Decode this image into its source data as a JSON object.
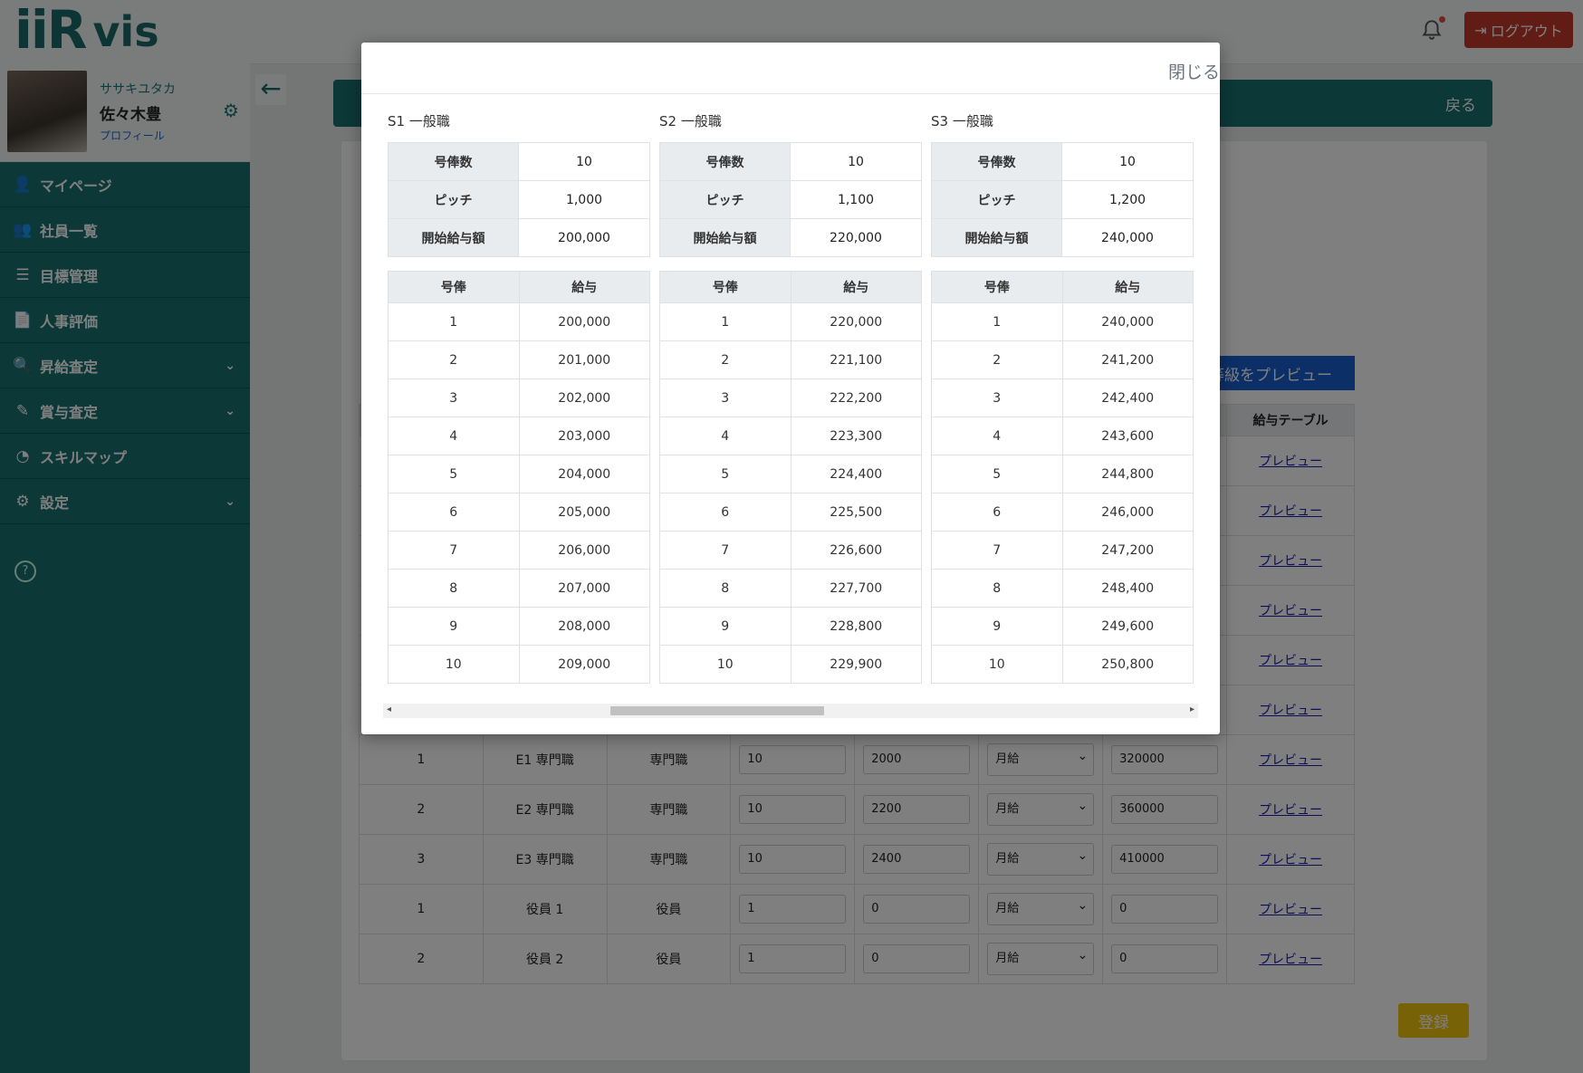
{
  "header": {
    "logo_text": "iiR",
    "logo_text2": "vis",
    "logout_label": "ログアウト"
  },
  "profile": {
    "kana": "ササキユタカ",
    "name": "佐々木豊",
    "link": "プロフィール"
  },
  "sidebar": {
    "items": [
      {
        "icon": "👤",
        "label": "マイページ",
        "chevron": ""
      },
      {
        "icon": "👥",
        "label": "社員一覧",
        "chevron": ""
      },
      {
        "icon": "☰",
        "label": "目標管理",
        "chevron": ""
      },
      {
        "icon": "📄",
        "label": "人事評価",
        "chevron": ""
      },
      {
        "icon": "🔍",
        "label": "昇給査定",
        "chevron": "⌄"
      },
      {
        "icon": "✎",
        "label": "賞与査定",
        "chevron": "⌄"
      },
      {
        "icon": "◔",
        "label": "スキルマップ",
        "chevron": ""
      },
      {
        "icon": "⚙",
        "label": "設定",
        "chevron": "⌄"
      }
    ]
  },
  "page": {
    "back_label": "戻る",
    "preview_all_label": "等級をプレビュー",
    "table_header_last": "給与テーブル",
    "register_label": "登録",
    "rows": [
      {
        "no": "1",
        "grade": "E1 専門職",
        "type": "専門職",
        "steps": "10",
        "pitch": "2000",
        "period": "月給",
        "start": "320000",
        "link": "プレビュー"
      },
      {
        "no": "2",
        "grade": "E2 専門職",
        "type": "専門職",
        "steps": "10",
        "pitch": "2200",
        "period": "月給",
        "start": "360000",
        "link": "プレビュー"
      },
      {
        "no": "3",
        "grade": "E3 専門職",
        "type": "専門職",
        "steps": "10",
        "pitch": "2400",
        "period": "月給",
        "start": "410000",
        "link": "プレビュー"
      },
      {
        "no": "1",
        "grade": "役員 1",
        "type": "役員",
        "steps": "1",
        "pitch": "0",
        "period": "月給",
        "start": "0",
        "link": "プレビュー"
      },
      {
        "no": "2",
        "grade": "役員 2",
        "type": "役員",
        "steps": "1",
        "pitch": "0",
        "period": "月給",
        "start": "0",
        "link": "プレビュー"
      }
    ],
    "hidden_links": [
      "プレビュー",
      "プレビュー",
      "プレビュー",
      "プレビュー",
      "プレビュー",
      "プレビュー"
    ]
  },
  "modal": {
    "close_label": "閉じる",
    "labels": {
      "steps": "号俸数",
      "pitch": "ピッチ",
      "start": "開始給与額",
      "col_step": "号俸",
      "col_salary": "給与"
    },
    "grades": [
      {
        "title": "S1 一般職",
        "steps": "10",
        "pitch": "1,000",
        "start": "200,000",
        "salaries": [
          "200,000",
          "201,000",
          "202,000",
          "203,000",
          "204,000",
          "205,000",
          "206,000",
          "207,000",
          "208,000",
          "209,000"
        ]
      },
      {
        "title": "S2 一般職",
        "steps": "10",
        "pitch": "1,100",
        "start": "220,000",
        "salaries": [
          "220,000",
          "221,100",
          "222,200",
          "223,300",
          "224,400",
          "225,500",
          "226,600",
          "227,700",
          "228,800",
          "229,900"
        ]
      },
      {
        "title": "S3 一般職",
        "steps": "10",
        "pitch": "1,200",
        "start": "240,000",
        "salaries": [
          "240,000",
          "241,200",
          "242,400",
          "243,600",
          "244,800",
          "246,000",
          "247,200",
          "248,400",
          "249,600",
          "250,800"
        ]
      }
    ],
    "step_numbers": [
      "1",
      "2",
      "3",
      "4",
      "5",
      "6",
      "7",
      "8",
      "9",
      "10"
    ]
  }
}
